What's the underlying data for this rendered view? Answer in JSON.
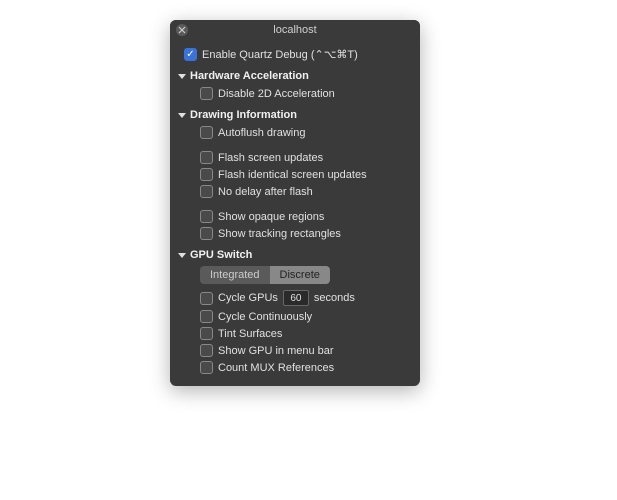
{
  "window": {
    "title": "localhost"
  },
  "enable_quartz_debug": {
    "label": "Enable Quartz Debug (⌃⌥⌘T)",
    "checked": true
  },
  "sections": {
    "hardware_acceleration": {
      "title": "Hardware Acceleration",
      "items": {
        "disable_2d": {
          "label": "Disable 2D Acceleration",
          "checked": false
        }
      }
    },
    "drawing_information": {
      "title": "Drawing Information",
      "items": {
        "autoflush": {
          "label": "Autoflush drawing",
          "checked": false
        },
        "flash_screen": {
          "label": "Flash screen updates",
          "checked": false
        },
        "flash_identical": {
          "label": "Flash identical screen updates",
          "checked": false
        },
        "no_delay": {
          "label": "No delay after flash",
          "checked": false
        },
        "show_opaque": {
          "label": "Show opaque regions",
          "checked": false
        },
        "show_tracking": {
          "label": "Show tracking rectangles",
          "checked": false
        }
      }
    },
    "gpu_switch": {
      "title": "GPU Switch",
      "segments": {
        "integrated": "Integrated",
        "discrete": "Discrete",
        "selected": "discrete"
      },
      "cycle_interval": {
        "prefix": "Cycle GPUs",
        "value": "60",
        "suffix": "seconds",
        "checked": false
      },
      "items": {
        "cycle_continuously": {
          "label": "Cycle Continuously",
          "checked": false
        },
        "tint_surfaces": {
          "label": "Tint Surfaces",
          "checked": false
        },
        "show_menu": {
          "label": "Show GPU in menu bar",
          "checked": false
        },
        "count_mux": {
          "label": "Count MUX References",
          "checked": false
        }
      }
    }
  }
}
